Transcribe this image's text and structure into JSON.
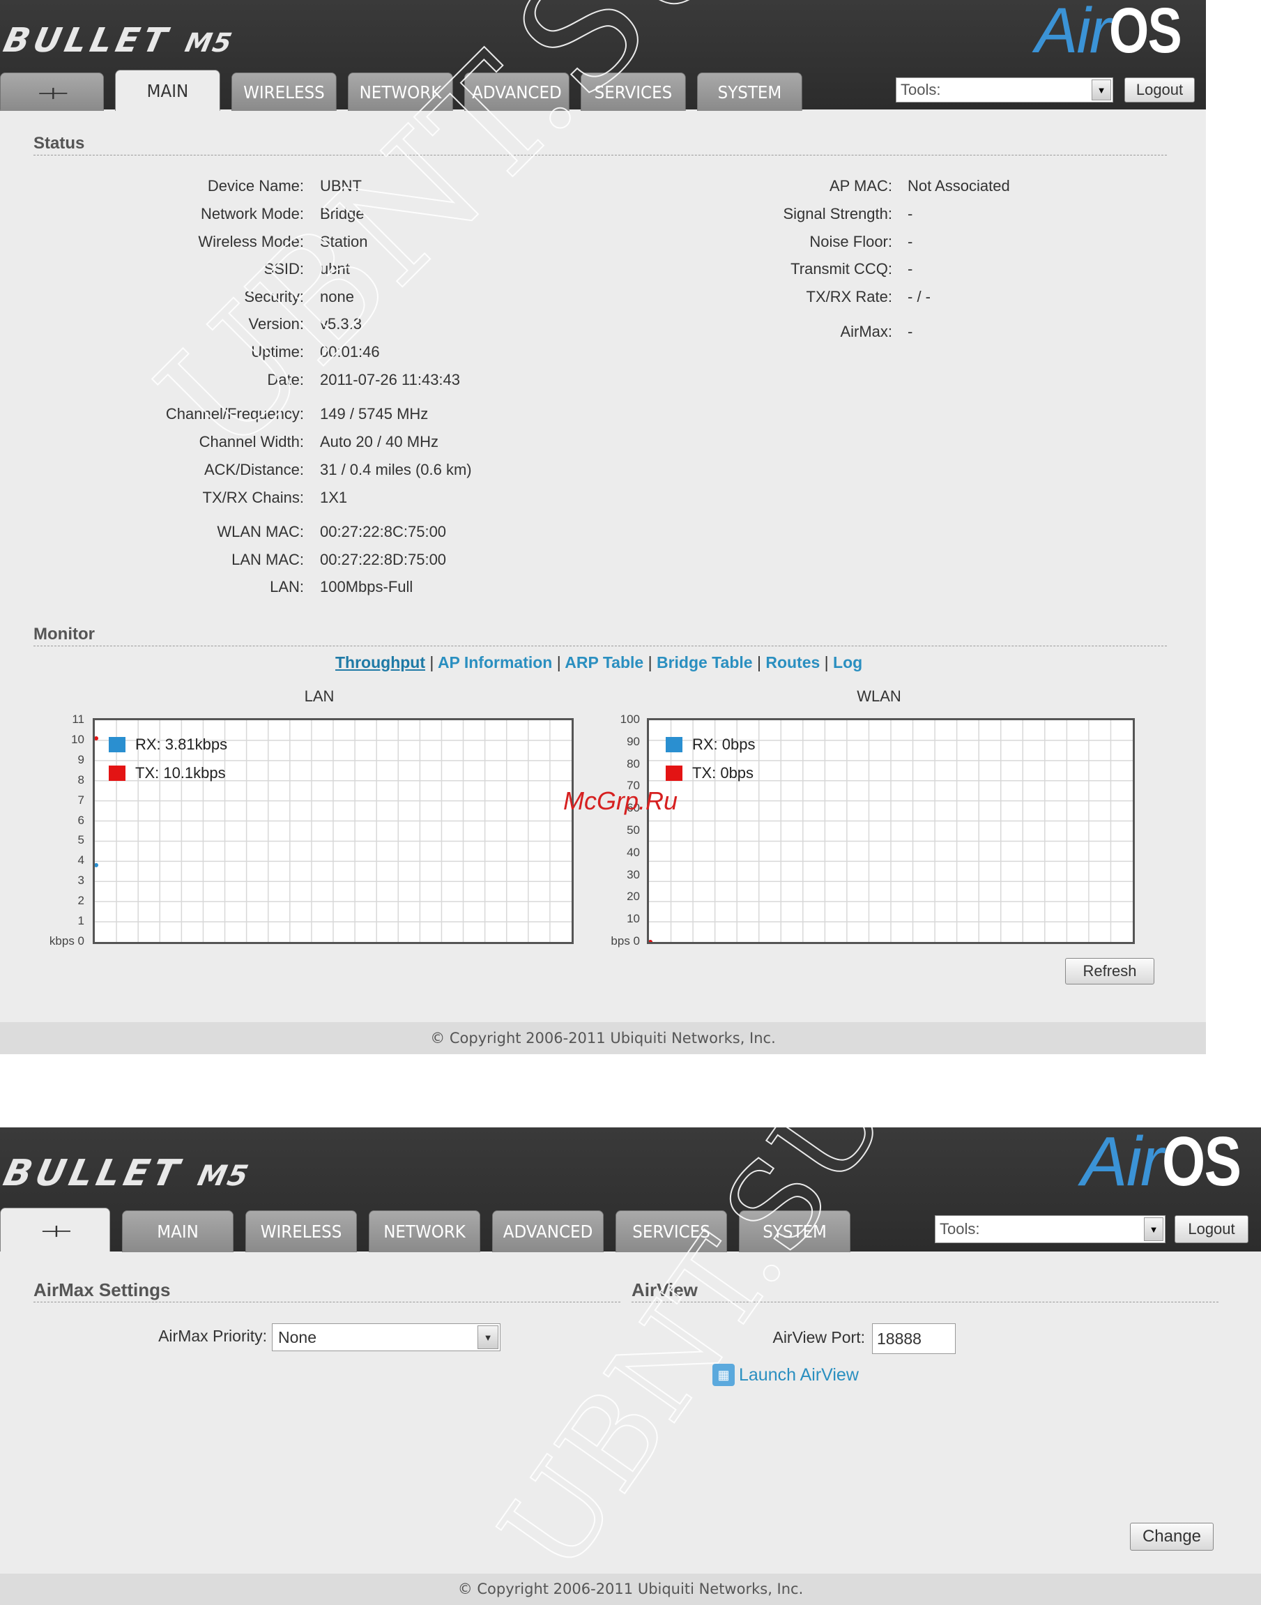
{
  "shot1": {
    "brand": "BULLET",
    "brand_model": "M5",
    "airos_air": "Air",
    "airos_os": "OS",
    "airos_tm": "™",
    "tabs": [
      {
        "label": "",
        "icon": "ubiquiti-logo-icon"
      },
      {
        "label": "MAIN"
      },
      {
        "label": "WIRELESS"
      },
      {
        "label": "NETWORK"
      },
      {
        "label": "ADVANCED"
      },
      {
        "label": "SERVICES"
      },
      {
        "label": "SYSTEM"
      }
    ],
    "active_tab": "MAIN",
    "tools_value": "Tools:",
    "logout_label": "Logout",
    "status_title": "Status",
    "left_labels": [
      "Device Name:",
      "Network Mode:",
      "Wireless Mode:",
      "SSID:",
      "Security:",
      "Version:",
      "Uptime:",
      "Date:",
      "Channel/Frequency:",
      "Channel Width:",
      "ACK/Distance:",
      "TX/RX Chains:",
      "WLAN MAC:",
      "LAN MAC:",
      "LAN:"
    ],
    "left_values": [
      "UBNT",
      "Bridge",
      "Station",
      "ubnt",
      "none",
      "v5.3.3",
      "00:01:46",
      "2011-07-26 11:43:43",
      "149 / 5745 MHz",
      "Auto 20 / 40 MHz",
      "31 / 0.4 miles (0.6 km)",
      "1X1",
      "00:27:22:8C:75:00",
      "00:27:22:8D:75:00",
      "100Mbps-Full"
    ],
    "right_labels": [
      "AP MAC:",
      "Signal Strength:",
      "Noise Floor:",
      "Transmit CCQ:",
      "TX/RX Rate:",
      "AirMax:"
    ],
    "right_values": [
      "Not Associated",
      "-",
      "-",
      "-",
      "- / -",
      "-"
    ],
    "monitor_title": "Monitor",
    "monitor_links": [
      "Throughput",
      "AP Information",
      "ARP Table",
      "Bridge Table",
      "Routes",
      "Log"
    ],
    "monitor_sep": "|",
    "refresh_label": "Refresh",
    "footer": "© Copyright 2006-2011 Ubiquiti Networks, Inc."
  },
  "chart_data": [
    {
      "type": "line",
      "title": "LAN",
      "y_ticks": [
        "11",
        "10",
        "9",
        "8",
        "7",
        "6",
        "5",
        "4",
        "3",
        "2",
        "1",
        "0"
      ],
      "y_unit": "kbps",
      "ylim": [
        0,
        11
      ],
      "grid": true,
      "legend_position": "top-left",
      "series": [
        {
          "name": "RX: 3.81kbps",
          "color": "#2a8fd0",
          "values": [
            3.81
          ]
        },
        {
          "name": "TX: 10.1kbps",
          "color": "#e31414",
          "values": [
            10.1
          ]
        }
      ]
    },
    {
      "type": "line",
      "title": "WLAN",
      "y_ticks": [
        "100",
        "90",
        "80",
        "70",
        "60",
        "50",
        "40",
        "30",
        "20",
        "10",
        "0"
      ],
      "y_unit": "bps",
      "ylim": [
        0,
        100
      ],
      "grid": true,
      "legend_position": "top-left",
      "series": [
        {
          "name": "RX: 0bps",
          "color": "#2a8fd0",
          "values": [
            0
          ]
        },
        {
          "name": "TX: 0bps",
          "color": "#e31414",
          "values": [
            0
          ]
        }
      ]
    }
  ],
  "shot2": {
    "brand": "BULLET",
    "brand_model": "M5",
    "airos_air": "Air",
    "airos_os": "OS",
    "airos_tm": "™",
    "tabs": [
      {
        "label": "",
        "icon": "ubiquiti-logo-icon"
      },
      {
        "label": "MAIN"
      },
      {
        "label": "WIRELESS"
      },
      {
        "label": "NETWORK"
      },
      {
        "label": "ADVANCED"
      },
      {
        "label": "SERVICES"
      },
      {
        "label": "SYSTEM"
      }
    ],
    "active_tab": "",
    "tools_value": "Tools:",
    "logout_label": "Logout",
    "airmax_title": "AirMax Settings",
    "airmax_priority_label": "AirMax Priority:",
    "airmax_priority_value": "None",
    "airview_title": "AirView",
    "airview_port_label": "AirView Port:",
    "airview_port_value": "18888",
    "launch_airview": "Launch AirView",
    "change_label": "Change",
    "footer": "© Copyright 2006-2011 Ubiquiti Networks, Inc."
  },
  "watermark": "McGrp.Ru",
  "colors": {
    "accent": "#2a8fc0",
    "header": "#333333",
    "panel": "#ececec"
  }
}
